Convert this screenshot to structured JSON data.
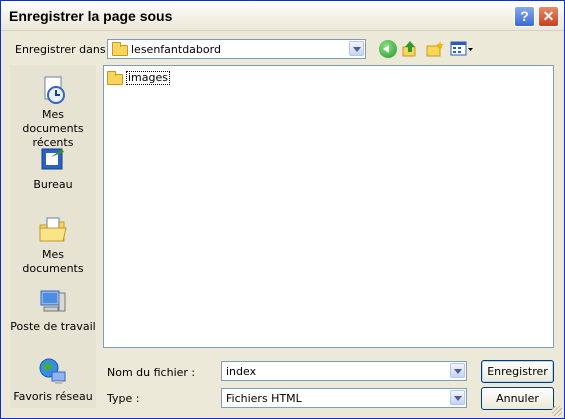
{
  "window": {
    "title": "Enregistrer la page sous"
  },
  "toolbar": {
    "lookin_label": "Enregistrer dans :",
    "lookin_value": "lesenfantdabord"
  },
  "places": [
    {
      "label": "Mes documents récents",
      "icon": "recent-documents-icon"
    },
    {
      "label": "Bureau",
      "icon": "desktop-icon"
    },
    {
      "label": "Mes documents",
      "icon": "my-documents-icon"
    },
    {
      "label": "Poste de travail",
      "icon": "my-computer-icon"
    },
    {
      "label": "Favoris réseau",
      "icon": "network-places-icon"
    }
  ],
  "files": [
    {
      "name": "images",
      "icon": "folder-icon"
    }
  ],
  "form": {
    "filename_label": "Nom du fichier :",
    "filename_value": "index",
    "type_label": "Type :",
    "type_value": "Fichiers HTML"
  },
  "buttons": {
    "save": "Enregistrer",
    "cancel": "Annuler"
  },
  "colors": {
    "dialog_bg": "#ece9d8",
    "places_bg": "#e6e3d3",
    "field_border": "#7f9db9",
    "folder": "#f9d65a"
  }
}
